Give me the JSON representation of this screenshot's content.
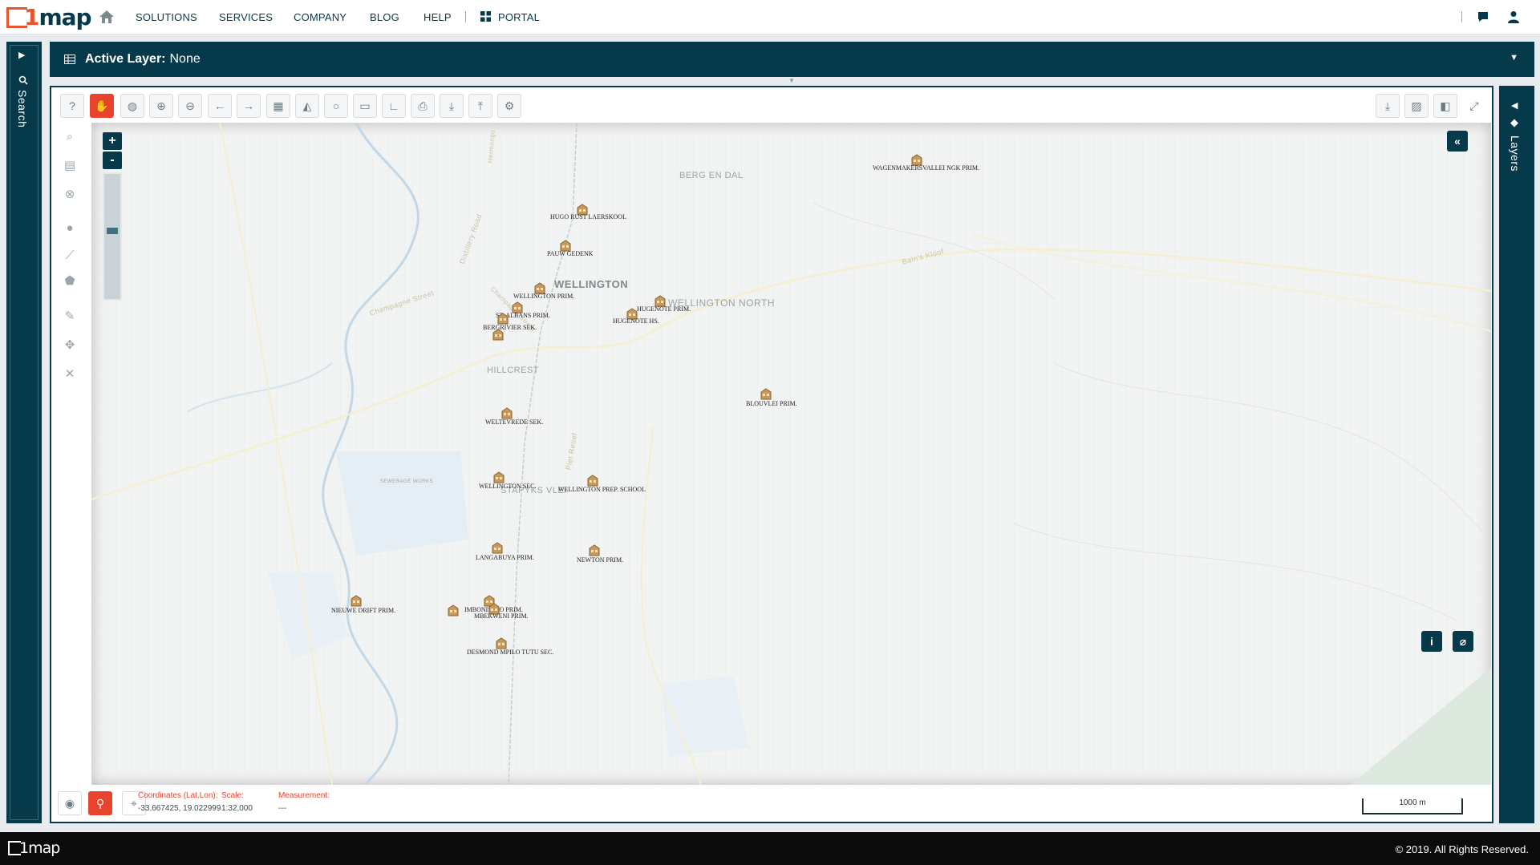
{
  "nav": {
    "brand": "1map",
    "links": [
      "SOLUTIONS",
      "SERVICES",
      "COMPANY",
      "BLOG",
      "HELP"
    ],
    "portal": "PORTAL"
  },
  "side": {
    "search_label": "Search",
    "layers_label": "Layers"
  },
  "layerbar": {
    "label": "Active Layer:",
    "value": "None"
  },
  "map": {
    "places": [
      {
        "name": "BERG EN DAL"
      },
      {
        "name": "WELLINGTON"
      },
      {
        "name": "WELLINGTON NORTH"
      },
      {
        "name": "HILLCREST"
      },
      {
        "name": "SEWERAGE WORKS"
      },
      {
        "name": "STAPYKS VLEI"
      }
    ],
    "roads": [
      {
        "name": "Champagne Street"
      },
      {
        "name": "Distillery Road"
      },
      {
        "name": "Piet Retief"
      },
      {
        "name": "Bain's Kloof"
      },
      {
        "name": "Hermongo"
      },
      {
        "name": "Champagne Street"
      }
    ],
    "schools": [
      {
        "name": "WAGENMAKERSVALLEI NGK PRIM."
      },
      {
        "name": "HUGO RUST LAERSKOOL"
      },
      {
        "name": "PAUW GEDENK"
      },
      {
        "name": "WELLINGTON PRIM."
      },
      {
        "name": "HUGENOTE PRIM."
      },
      {
        "name": "HUGENOTE HS."
      },
      {
        "name": "ST. ALBANS PRIM."
      },
      {
        "name": "BERGRIVIER SEK."
      },
      {
        "name": "BLOUVLEI PRIM."
      },
      {
        "name": "WELTEVREDE SEK."
      },
      {
        "name": "WELLINGTON SEC."
      },
      {
        "name": "WELLINGTON PREP. SCHOOL"
      },
      {
        "name": "LANGABUYA PRIM."
      },
      {
        "name": "NEWTON PRIM."
      },
      {
        "name": "NIEUWE DRIFT PRIM."
      },
      {
        "name": "IMBONISELO PRIM."
      },
      {
        "name": "MBEKWENI PRIM."
      },
      {
        "name": "DESMOND MPILO TUTU SEC."
      }
    ],
    "zoom_level_fraction": 0.55
  },
  "footer": {
    "coords_label": "Coordinates (Lat,Lon):",
    "coords_value": "-33.667425, 19.022999",
    "scale_label": "Scale:",
    "scale_value": "1:32,000",
    "measure_label": "Measurement:",
    "measure_value": "---",
    "scalebar": "1000 m"
  },
  "bottom": {
    "brand": "1map",
    "copyright": "© 2019. All Rights Reserved."
  },
  "colors": {
    "primary": "#06394a",
    "accent": "#e8432c",
    "brand_orange": "#e8542f"
  }
}
